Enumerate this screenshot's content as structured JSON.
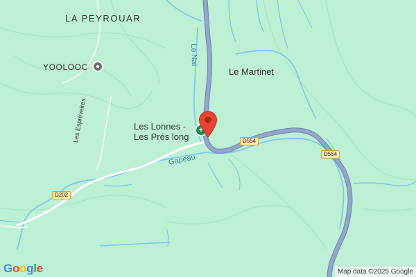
{
  "map": {
    "labels": {
      "la_peyrouar": "LA PEYROUAR",
      "yoolooc": "YOOLOOC",
      "le_martinet": "Le Martinet",
      "les_lonnes_1": "Les Lonnes -",
      "les_lonnes_2": "Les Prés long",
      "les_espreveires": "Les Espreveires",
      "le_nai": "Le Naï",
      "gapeau": "Gapeau"
    },
    "road_shields": {
      "d202": "D202",
      "d554_a": "D554",
      "d554_b": "D554"
    },
    "marker": {
      "icon": "map-pin-icon",
      "color": "#e53935"
    },
    "logo": {
      "letters": [
        "G",
        "o",
        "o",
        "g",
        "l",
        "e"
      ],
      "colors": [
        "#4285F4",
        "#EA4335",
        "#FBBC05",
        "#4285F4",
        "#34A853",
        "#EA4335"
      ]
    },
    "attribution": "Map data ©2025 Google",
    "colors": {
      "land": "#bdf0d4",
      "water": "#7fc8e8",
      "main_road": "#8a9dc1",
      "minor_road": "#ffffff"
    }
  }
}
